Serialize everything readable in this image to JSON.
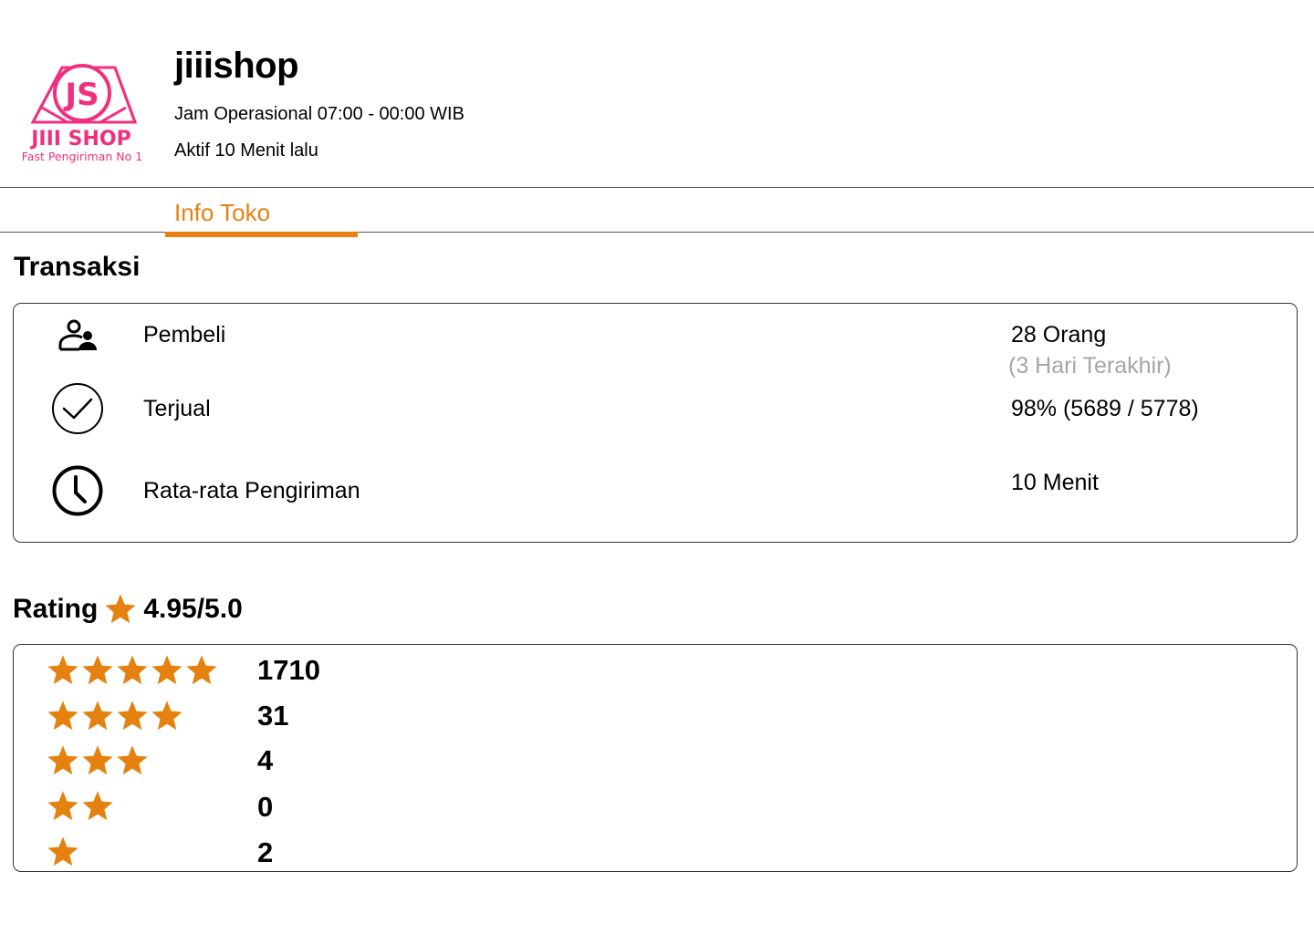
{
  "shop": {
    "logo_initials": "JS",
    "logo_name": "JIII SHOP",
    "logo_tagline": "Fast Pengiriman No 1",
    "name": "jiiishop",
    "hours": "Jam Operasional 07:00 - 00:00 WIB",
    "active": "Aktif 10 Menit lalu"
  },
  "tabs": [
    {
      "label": "Info Toko",
      "active": true
    }
  ],
  "transaksi": {
    "title": "Transaksi",
    "rows": [
      {
        "icon": "buyers-icon",
        "label": "Pembeli",
        "value": "28 Orang",
        "sub": "(3 Hari Terakhir)"
      },
      {
        "icon": "check-circle-icon",
        "label": "Terjual",
        "value": "98% (5689 / 5778)"
      },
      {
        "icon": "clock-icon",
        "label": "Rata-rata Pengiriman",
        "value": "10 Menit"
      }
    ]
  },
  "rating": {
    "title": "Rating",
    "score": "4.95/5.0",
    "breakdown": [
      {
        "stars": 5,
        "count": "1710"
      },
      {
        "stars": 4,
        "count": "31"
      },
      {
        "stars": 3,
        "count": "4"
      },
      {
        "stars": 2,
        "count": "0"
      },
      {
        "stars": 1,
        "count": "2"
      }
    ]
  },
  "colors": {
    "accent": "#e5820f",
    "logo": "#f0307e",
    "muted": "#a6a6a6"
  }
}
